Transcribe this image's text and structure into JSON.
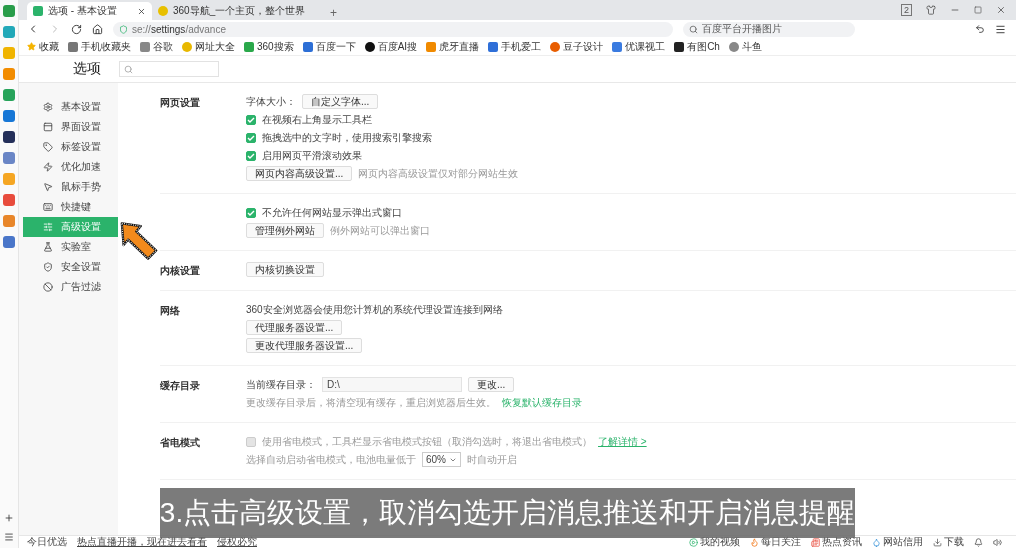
{
  "tabs": [
    {
      "label": "选项 - 基本设置",
      "selected": true
    },
    {
      "label": "360导航_一个主页，整个世界",
      "selected": false
    }
  ],
  "new_tab": "+",
  "window_badge": "2",
  "address": {
    "scheme": "se://",
    "host": "settings",
    "path": "/advance"
  },
  "top_search": {
    "value": "百度平台开播图片"
  },
  "bookmarks": [
    "收藏",
    "手机收藏夹",
    "谷歌",
    "网址大全",
    "360搜索",
    "百度一下",
    "百度AI搜",
    "虎牙直播",
    "手机爱工",
    "豆子设计",
    "优课视工",
    "有图Ch",
    "斗鱼"
  ],
  "page_title": "选项",
  "sidebar": [
    {
      "label": "基本设置",
      "selected": false
    },
    {
      "label": "界面设置",
      "selected": false
    },
    {
      "label": "标签设置",
      "selected": false
    },
    {
      "label": "优化加速",
      "selected": false
    },
    {
      "label": "鼠标手势",
      "selected": false
    },
    {
      "label": "快捷键",
      "selected": false
    },
    {
      "label": "高级设置",
      "selected": true
    },
    {
      "label": "实验室",
      "selected": false
    },
    {
      "label": "安全设置",
      "selected": false
    },
    {
      "label": "广告过滤",
      "selected": false
    }
  ],
  "sections": [
    {
      "heading": "网页设置",
      "items": [
        {
          "kind": "field-button",
          "label": "字体大小：",
          "button": "自定义字体..."
        },
        {
          "kind": "checkbox",
          "label": "在视频右上角显示工具栏",
          "checked": true
        },
        {
          "kind": "checkbox",
          "label": "拖拽选中的文字时，使用搜索引擎搜索",
          "checked": true
        },
        {
          "kind": "checkbox",
          "label": "启用网页平滑滚动效果",
          "checked": true
        },
        {
          "kind": "button",
          "button": "网页内容高级设置...",
          "note": "网页内容高级设置仅对部分网站生效"
        }
      ]
    },
    {
      "items": [
        {
          "kind": "checkbox",
          "label": "不允许任何网站显示弹出式窗口",
          "checked": true
        },
        {
          "kind": "button",
          "button": "管理例外网站",
          "note": "例外网站可以弹出窗口"
        }
      ]
    },
    {
      "heading": "内核设置",
      "items": [
        {
          "kind": "button",
          "button": "内核切换设置"
        }
      ]
    },
    {
      "heading": "网络",
      "items": [
        {
          "kind": "text",
          "text": "360安全浏览器会使用您计算机的系统代理设置连接到网络"
        },
        {
          "kind": "button",
          "button": "代理服务器设置..."
        },
        {
          "kind": "button",
          "button": "更改代理服务器设置..."
        }
      ]
    },
    {
      "heading": "缓存目录",
      "items": [
        {
          "kind": "path",
          "label": "当前缓存目录：",
          "value": "D:\\",
          "button": "更改..."
        },
        {
          "kind": "note-link",
          "text": "更改缓存目录后，将清空现有缓存，重启浏览器后生效。",
          "link": "恢复默认缓存目录"
        }
      ]
    },
    {
      "heading": "省电模式",
      "items": [
        {
          "kind": "checkbox",
          "label": "使用省电模式，工具栏显示省电模式按钮（取消勾选时，将退出省电模式）",
          "checked": false,
          "disabled": true,
          "link": "了解详情 >"
        },
        {
          "kind": "select",
          "before": "选择自动启动省电模式，电池电量低于",
          "value": "60%",
          "after": "时自动开启"
        }
      ]
    }
  ],
  "caption": "3.点击高级设置，取消勾选开启消息推送和开启消息提醒",
  "status_left": [
    "今日优选",
    "热点直播开播，现在进去看看",
    "侵权必究"
  ],
  "status_right": [
    "我的视频",
    "每日关注",
    "热点资讯",
    "网站信用",
    "下载"
  ]
}
